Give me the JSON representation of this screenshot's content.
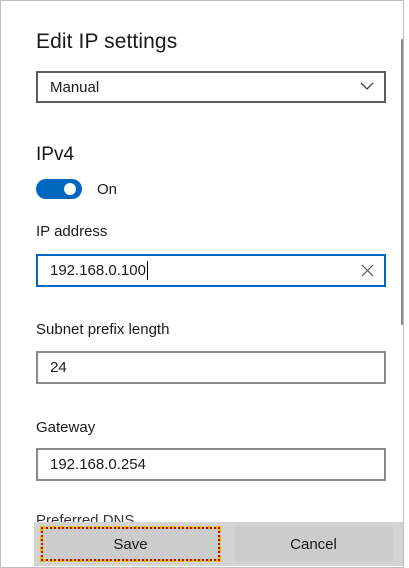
{
  "dialog": {
    "title": "Edit IP settings",
    "mode_select": {
      "value": "Manual"
    },
    "section_title": "IPv4",
    "ipv4_toggle": {
      "state_label": "On",
      "on": true
    },
    "fields": [
      {
        "label": "IP address",
        "value": "192.168.0.100",
        "focused": true
      },
      {
        "label": "Subnet prefix length",
        "value": "24"
      },
      {
        "label": "Gateway",
        "value": "192.168.0.254"
      }
    ],
    "cutoff_label": "Preferred DNS"
  },
  "buttons": {
    "save": "Save",
    "cancel": "Cancel"
  },
  "colors": {
    "accent": "#0067c0",
    "footer_bg": "#d3d3d3",
    "focus_highlight_yellow": "#e3c100",
    "focus_highlight_red": "#d10000"
  }
}
